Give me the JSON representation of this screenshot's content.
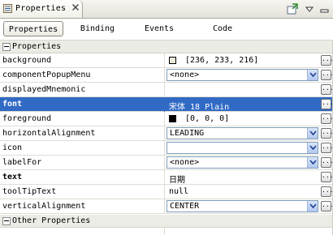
{
  "view": {
    "title": "Properties",
    "close_glyph": "✕"
  },
  "tabs": [
    {
      "label": "Properties"
    },
    {
      "label": "Binding"
    },
    {
      "label": "Events"
    },
    {
      "label": "Code"
    }
  ],
  "categories": [
    {
      "label": "Properties"
    },
    {
      "label": "Other Properties"
    }
  ],
  "properties": [
    {
      "name": "background",
      "value": "[236, 233, 216]",
      "swatch": "#ece9d8"
    },
    {
      "name": "componentPopupMenu",
      "value": "<none>"
    },
    {
      "name": "displayedMnemonic",
      "value": ""
    },
    {
      "name": "font",
      "value": "宋体 18 Plain"
    },
    {
      "name": "foreground",
      "value": "[0, 0, 0]",
      "swatch": "#000000"
    },
    {
      "name": "horizontalAlignment",
      "value": "LEADING"
    },
    {
      "name": "icon",
      "value": ""
    },
    {
      "name": "labelFor",
      "value": "<none>"
    },
    {
      "name": "text",
      "value": "日期"
    },
    {
      "name": "toolTipText",
      "value": "null"
    },
    {
      "name": "verticalAlignment",
      "value": "CENTER"
    }
  ],
  "ellipsis": "...",
  "colors": {
    "selection": "#316ac5",
    "category_bg": "#ecece6",
    "grid": "#dedcd3"
  }
}
